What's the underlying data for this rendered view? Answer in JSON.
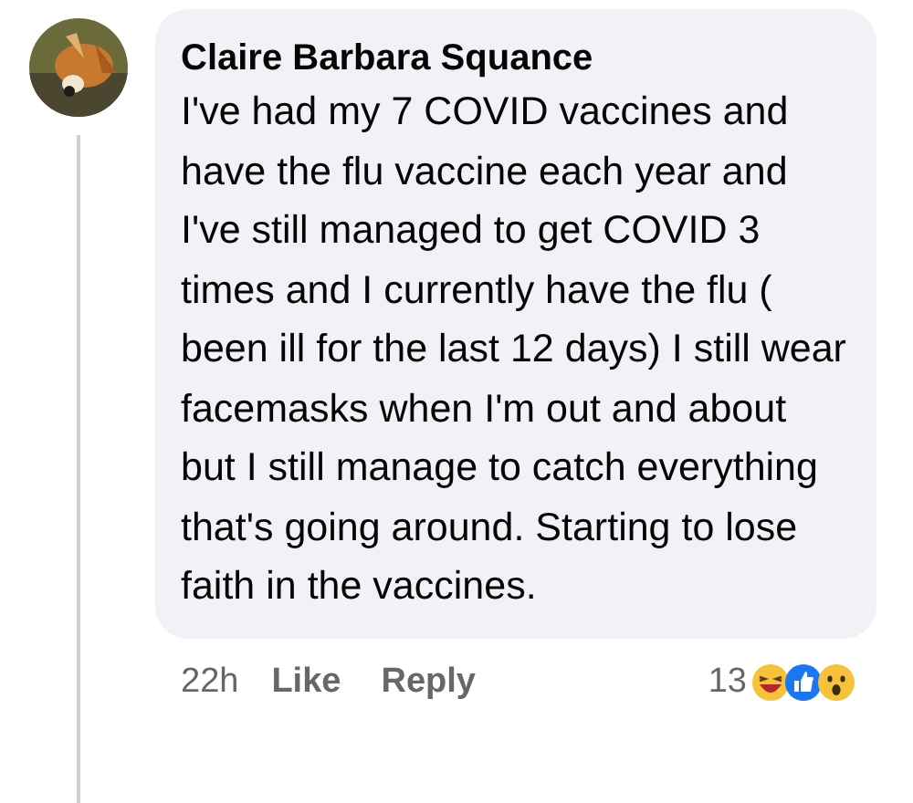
{
  "comment": {
    "author": "Claire Barbara Squance",
    "text": "I've had my 7 COVID vaccines and have the flu vaccine each year and I've still managed to get COVID 3 times and I currently have the flu ( been ill for the last 12 days) I still wear facemasks when I'm out and about but I still manage to catch everything that's going around. Starting to lose faith in the vaccines.",
    "time": "22h",
    "actions": [
      "Like",
      "Reply"
    ],
    "reaction_count": "13"
  }
}
